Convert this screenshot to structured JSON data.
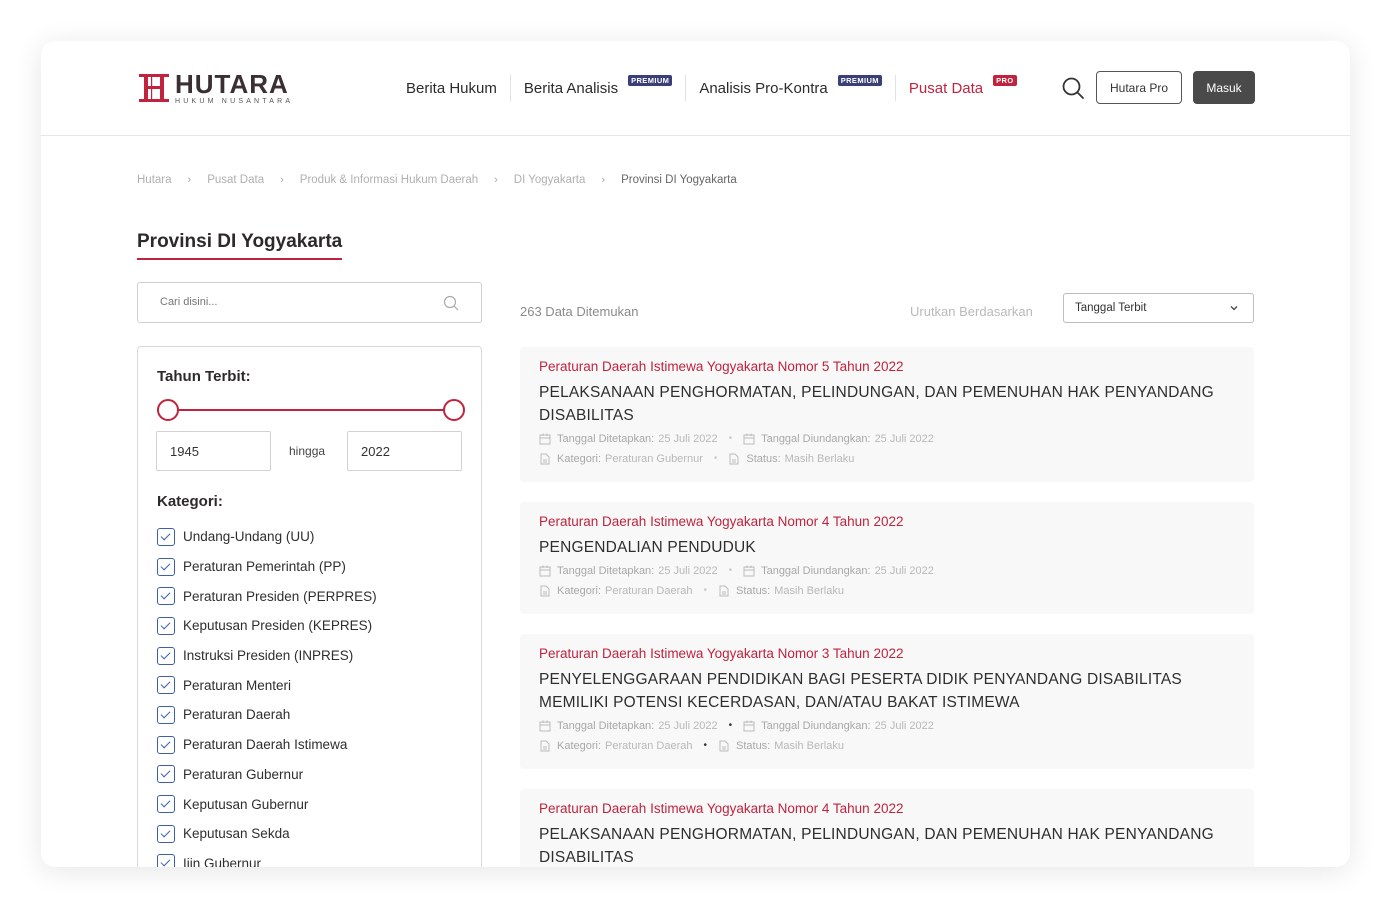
{
  "brand": {
    "name": "HUTARA",
    "tagline": "HUKUM NUSANTARA",
    "accent": "#c0233e"
  },
  "nav": {
    "items": [
      {
        "label": "Berita Hukum",
        "badge": ""
      },
      {
        "label": "Berita Analisis",
        "badge": "PREMIUM"
      },
      {
        "label": "Analisis Pro-Kontra",
        "badge": "PREMIUM"
      },
      {
        "label": "Pusat Data",
        "badge": "PRO"
      }
    ],
    "pro_button": "Hutara Pro",
    "login_button": "Masuk"
  },
  "breadcrumb": [
    "Hutara",
    "Pusat Data",
    "Produk & Informasi Hukum Daerah",
    "DI Yogyakarta",
    "Provinsi DI Yogyakarta"
  ],
  "page_title": "Provinsi DI Yogyakarta",
  "search": {
    "placeholder": "Cari disini..."
  },
  "filter": {
    "year_heading": "Tahun Terbit:",
    "year_from": "1945",
    "year_to": "2022",
    "range_word": "hingga",
    "category_heading": "Kategori:",
    "categories": [
      "Undang-Undang (UU)",
      "Peraturan Pemerintah (PP)",
      "Peraturan Presiden (PERPRES)",
      "Keputusan Presiden (KEPRES)",
      "Instruksi Presiden (INPRES)",
      "Peraturan Menteri",
      "Peraturan Daerah",
      "Peraturan Daerah Istimewa",
      "Peraturan Gubernur",
      "Keputusan Gubernur",
      "Keputusan Sekda",
      "Ijin Gubernur"
    ]
  },
  "results": {
    "count_text": "263 Data Ditemukan",
    "sort_label": "Urutkan Berdasarkan",
    "sort_value": "Tanggal Terbit",
    "meta_labels": {
      "tetap": "Tanggal Ditetapkan:",
      "undang": "Tanggal Diundangkan:",
      "kategori": "Kategori:",
      "status": "Status:"
    },
    "items": [
      {
        "subtitle": "Peraturan Daerah Istimewa Yogyakarta Nomor 5 Tahun 2022",
        "title": "PELAKSANAAN PENGHORMATAN, PELINDUNGAN, DAN PEMENUHAN HAK PENYANDANG DISABILITAS",
        "ditetapkan": "25 Juli 2022",
        "diundangkan": "25 Juli 2022",
        "kategori": "Peraturan Gubernur",
        "status": "Masih Berlaku"
      },
      {
        "subtitle": "Peraturan Daerah Istimewa Yogyakarta Nomor 4 Tahun 2022",
        "title": "PENGENDALIAN PENDUDUK",
        "ditetapkan": "25 Juli 2022",
        "diundangkan": "25 Juli 2022",
        "kategori": "Peraturan Daerah",
        "status": "Masih Berlaku"
      },
      {
        "subtitle": "Peraturan Daerah Istimewa Yogyakarta Nomor 3 Tahun 2022",
        "title": "PENYELENGGARAAN PENDIDIKAN BAGI PESERTA DIDIK PENYANDANG DISABILITAS MEMILIKI POTENSI KECERDASAN, DAN/ATAU BAKAT ISTIMEWA",
        "ditetapkan": "25 Juli 2022",
        "diundangkan": "25 Juli 2022",
        "kategori": "Peraturan Daerah",
        "status": "Masih Berlaku"
      },
      {
        "subtitle": "Peraturan Daerah Istimewa Yogyakarta Nomor 4 Tahun 2022",
        "title": "PELAKSANAAN PENGHORMATAN, PELINDUNGAN, DAN PEMENUHAN HAK PENYANDANG DISABILITAS"
      }
    ]
  }
}
